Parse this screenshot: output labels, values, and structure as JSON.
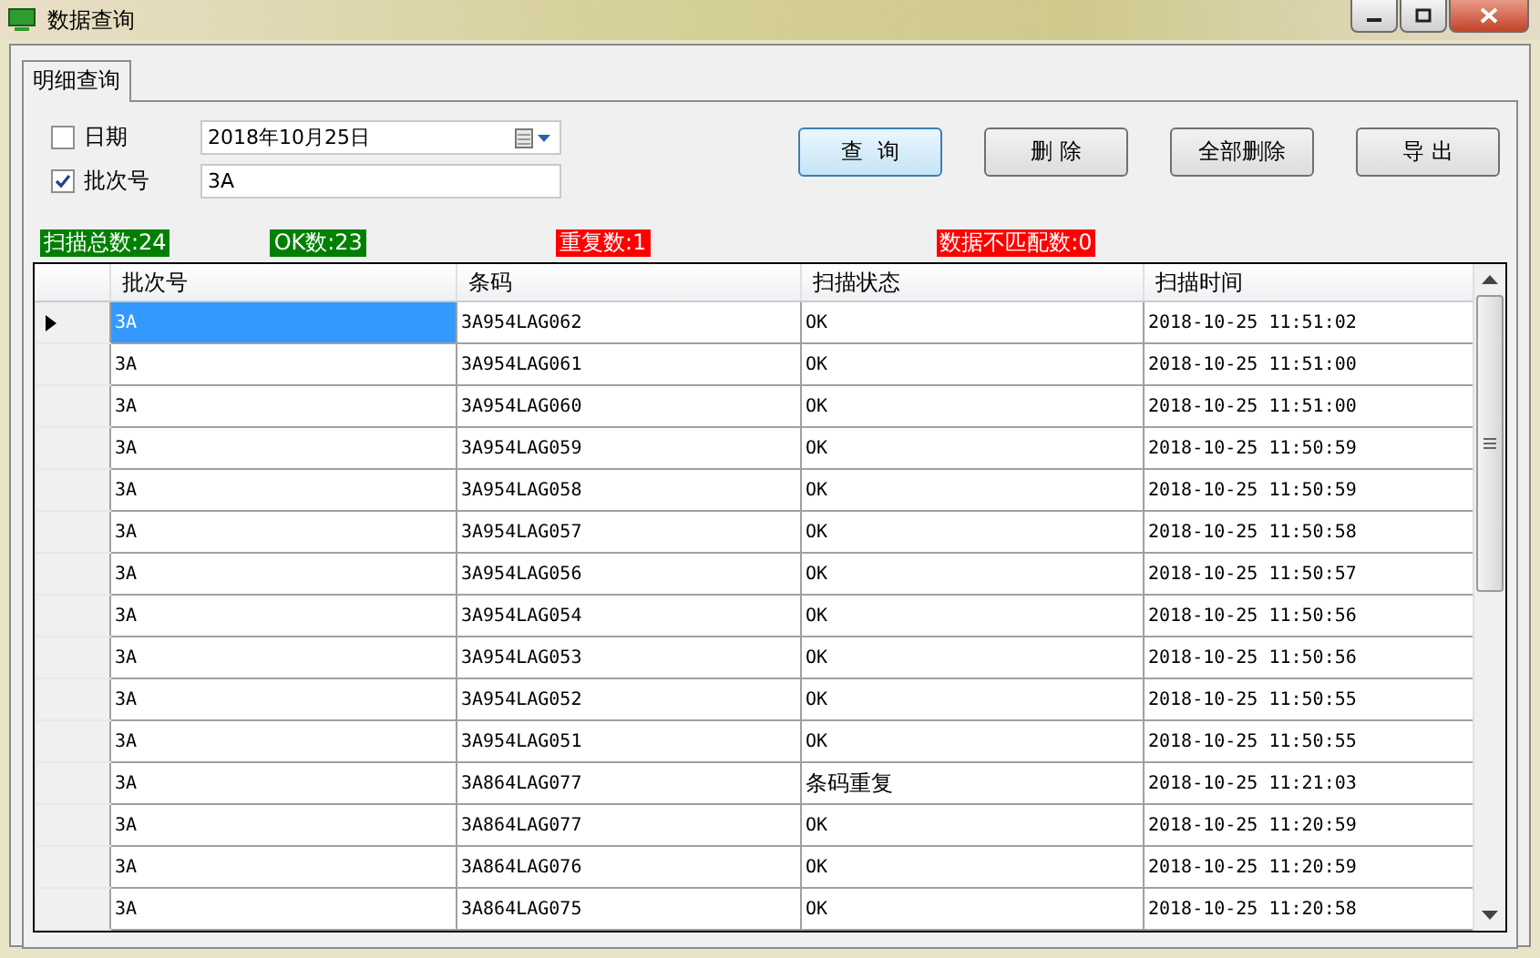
{
  "window": {
    "title": "数据查询"
  },
  "tabs": [
    {
      "label": "明细查询",
      "selected": true
    }
  ],
  "filters": [
    {
      "label": "日期",
      "checked": false,
      "value": "2018年10月25日",
      "kind": "date"
    },
    {
      "label": "批次号",
      "checked": true,
      "value": "3A",
      "kind": "text"
    }
  ],
  "buttons": [
    {
      "label": "查  询",
      "selected": true
    },
    {
      "label": "删 除",
      "selected": false
    },
    {
      "label": "全部删除",
      "selected": false
    },
    {
      "label": "导 出",
      "selected": false
    }
  ],
  "stats": [
    {
      "text": "扫描总数:24",
      "color": "#008000"
    },
    {
      "text": "OK数:23",
      "color": "#008000"
    },
    {
      "text": "重复数:1",
      "color": "#ff0000"
    },
    {
      "text": "数据不匹配数:0",
      "color": "#ff0000"
    }
  ],
  "table": {
    "columns": [
      "批次号",
      "条码",
      "扫描状态",
      "扫描时间"
    ],
    "rows": [
      {
        "cells": [
          "3A",
          "3A954LAG062",
          "OK",
          "2018-10-25 11:51:02"
        ],
        "selected": true
      },
      {
        "cells": [
          "3A",
          "3A954LAG061",
          "OK",
          "2018-10-25 11:51:00"
        ],
        "selected": false
      },
      {
        "cells": [
          "3A",
          "3A954LAG060",
          "OK",
          "2018-10-25 11:51:00"
        ],
        "selected": false
      },
      {
        "cells": [
          "3A",
          "3A954LAG059",
          "OK",
          "2018-10-25 11:50:59"
        ],
        "selected": false
      },
      {
        "cells": [
          "3A",
          "3A954LAG058",
          "OK",
          "2018-10-25 11:50:59"
        ],
        "selected": false
      },
      {
        "cells": [
          "3A",
          "3A954LAG057",
          "OK",
          "2018-10-25 11:50:58"
        ],
        "selected": false
      },
      {
        "cells": [
          "3A",
          "3A954LAG056",
          "OK",
          "2018-10-25 11:50:57"
        ],
        "selected": false
      },
      {
        "cells": [
          "3A",
          "3A954LAG054",
          "OK",
          "2018-10-25 11:50:56"
        ],
        "selected": false
      },
      {
        "cells": [
          "3A",
          "3A954LAG053",
          "OK",
          "2018-10-25 11:50:56"
        ],
        "selected": false
      },
      {
        "cells": [
          "3A",
          "3A954LAG052",
          "OK",
          "2018-10-25 11:50:55"
        ],
        "selected": false
      },
      {
        "cells": [
          "3A",
          "3A954LAG051",
          "OK",
          "2018-10-25 11:50:55"
        ],
        "selected": false
      },
      {
        "cells": [
          "3A",
          "3A864LAG077",
          "条码重复",
          "2018-10-25 11:21:03"
        ],
        "selected": false
      },
      {
        "cells": [
          "3A",
          "3A864LAG077",
          "OK",
          "2018-10-25 11:20:59"
        ],
        "selected": false
      },
      {
        "cells": [
          "3A",
          "3A864LAG076",
          "OK",
          "2018-10-25 11:20:59"
        ],
        "selected": false
      },
      {
        "cells": [
          "3A",
          "3A864LAG075",
          "OK",
          "2018-10-25 11:20:58"
        ],
        "selected": false
      }
    ]
  }
}
